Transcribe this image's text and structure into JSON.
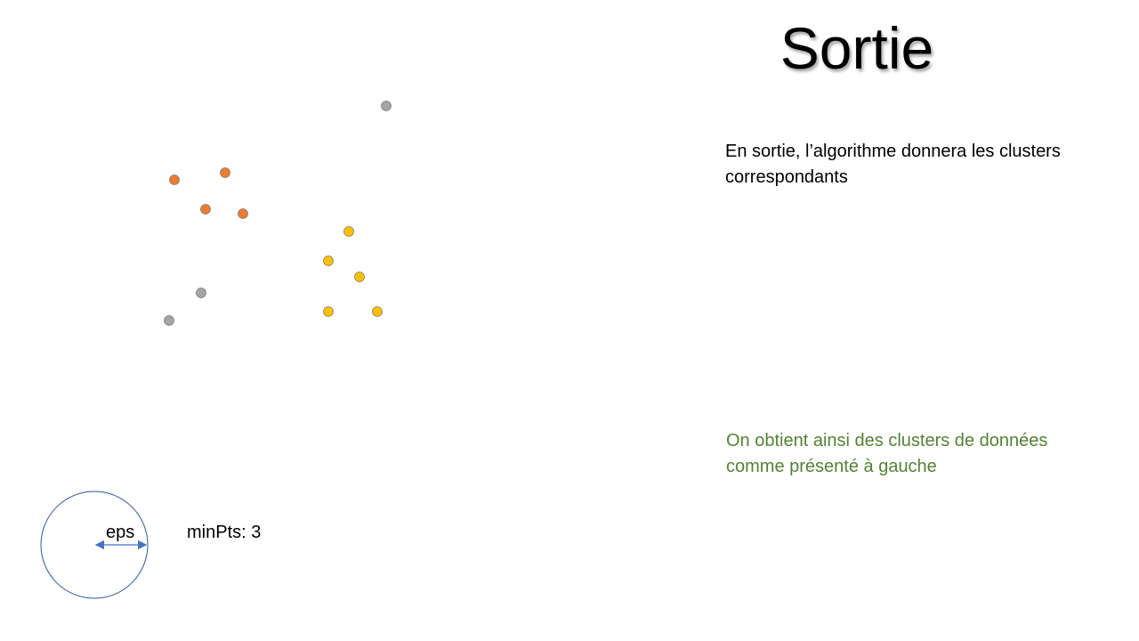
{
  "slide": {
    "title": "Sortie",
    "description": "En sortie, l’algorithme donnera les clusters correspondants",
    "conclusion": "On obtient ainsi des clusters de données comme présenté à gauche",
    "eps_label": "eps",
    "minpts_label": "minPts: 3"
  },
  "colors": {
    "cluster_orange": "#ED7D31",
    "cluster_yellow": "#FFC000",
    "noise_gray": "#A5A5A5",
    "circle_stroke": "#2F5597",
    "conclusion_text": "#548235"
  },
  "points": [
    {
      "group": "noise",
      "color": "#A5A5A5"
    },
    {
      "group": "orange",
      "color": "#ED7D31"
    },
    {
      "group": "orange",
      "color": "#ED7D31"
    },
    {
      "group": "orange",
      "color": "#ED7D31"
    },
    {
      "group": "orange",
      "color": "#ED7D31"
    },
    {
      "group": "yellow",
      "color": "#FFC000"
    },
    {
      "group": "yellow",
      "color": "#FFC000"
    },
    {
      "group": "yellow",
      "color": "#FFC000"
    },
    {
      "group": "yellow",
      "color": "#FFC000"
    },
    {
      "group": "yellow",
      "color": "#FFC000"
    },
    {
      "group": "noise",
      "color": "#A5A5A5"
    },
    {
      "group": "noise",
      "color": "#A5A5A5"
    }
  ]
}
